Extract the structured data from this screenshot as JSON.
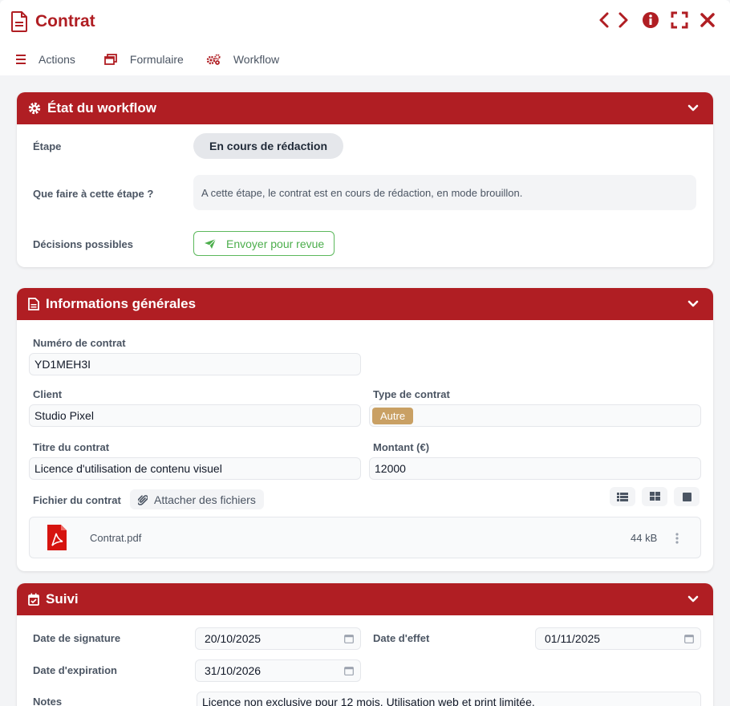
{
  "header": {
    "title": "Contrat",
    "toolbar": {
      "actions": "Actions",
      "form": "Formulaire",
      "workflow": "Workflow"
    }
  },
  "workflow_panel": {
    "title": "État du workflow",
    "step_label": "Étape",
    "step_value": "En cours de rédaction",
    "todo_label": "Que faire à cette étape ?",
    "todo_text": "A cette étape, le contrat est en cours de rédaction, en mode brouillon.",
    "decisions_label": "Décisions possibles",
    "send_button": "Envoyer pour revue"
  },
  "general_panel": {
    "title": "Informations générales",
    "contract_number_label": "Numéro de contrat",
    "contract_number": "YD1MEH3I",
    "client_label": "Client",
    "client": "Studio Pixel",
    "type_label": "Type de contrat",
    "type": "Autre",
    "contract_title_label": "Titre du contrat",
    "contract_title": "Licence d'utilisation de contenu visuel",
    "amount_label": "Montant (€)",
    "amount": "12000",
    "file_label": "Fichier du contrat",
    "attach_button": "Attacher des fichiers",
    "file": {
      "name": "Contrat.pdf",
      "size": "44 kB"
    }
  },
  "tracking_panel": {
    "title": "Suivi",
    "signature_label": "Date de signature",
    "signature_date": "20/10/2025",
    "effective_label": "Date d'effet",
    "effective_date": "01/11/2025",
    "expiration_label": "Date d'expiration",
    "expiration_date": "31/10/2026",
    "notes_label": "Notes",
    "notes": "Licence non exclusive pour 12 mois. Utilisation web et print limitée."
  },
  "colors": {
    "brand": "#b01e23",
    "success": "#5cb85c",
    "badge": "#c9a064"
  }
}
